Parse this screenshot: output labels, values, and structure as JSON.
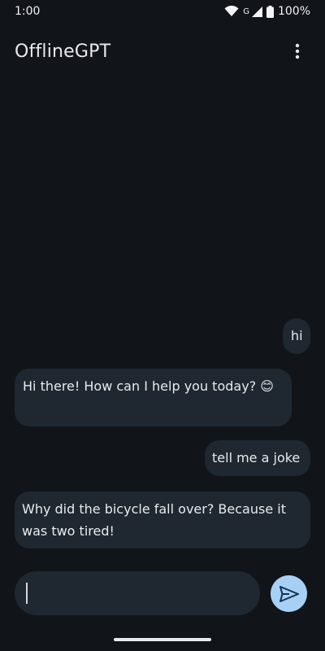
{
  "status_bar": {
    "time": "1:00",
    "network_label": "G",
    "battery_percent": "100%",
    "icons": [
      "wifi-icon",
      "cell-signal-icon",
      "battery-icon"
    ]
  },
  "app_bar": {
    "title": "OfflineGPT",
    "menu_icon": "more-vert-icon"
  },
  "messages": [
    {
      "role": "user",
      "text": "hi"
    },
    {
      "role": "assistant",
      "text": "Hi there! How can I help you today? 😊"
    },
    {
      "role": "user",
      "text": "tell me a joke"
    },
    {
      "role": "assistant",
      "text": "Why did the bicycle fall over? Because it was two tired!"
    }
  ],
  "composer": {
    "value": "",
    "placeholder": "",
    "send_icon": "send-icon"
  },
  "colors": {
    "background": "#111419",
    "bubble": "#1f2831",
    "send_button": "#a8d0f5",
    "text": "#e8eaed"
  }
}
